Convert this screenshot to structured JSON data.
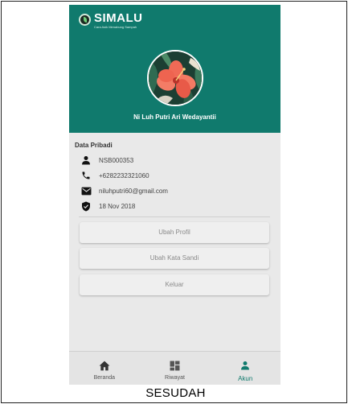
{
  "app": {
    "logo_name": "SIMALU",
    "logo_tagline": "Cara Asik Menabung Sampah"
  },
  "profile": {
    "name": "Ni Luh Putri Ari Wedayantii"
  },
  "personal": {
    "title": "Data Pribadi",
    "fields": [
      {
        "icon": "person-icon",
        "value": "NSB000353"
      },
      {
        "icon": "phone-icon",
        "value": "+6282232321060"
      },
      {
        "icon": "mail-icon",
        "value": "niluhputri60@gmail.com"
      },
      {
        "icon": "verified-shield-icon",
        "value": "18 Nov 2018"
      }
    ]
  },
  "actions": {
    "edit_profile": "Ubah Profil",
    "change_password": "Ubah Kata Sandi",
    "logout": "Keluar"
  },
  "nav": {
    "items": [
      {
        "icon": "home-icon",
        "label": "Beranda"
      },
      {
        "icon": "dashboard-icon",
        "label": "Riwayat"
      },
      {
        "icon": "person-icon",
        "label": "Akun"
      }
    ],
    "active": "Akun"
  },
  "caption": "SESUDAH",
  "colors": {
    "primary": "#107a6d",
    "background": "#e9e9e9",
    "button": "#efefef"
  }
}
